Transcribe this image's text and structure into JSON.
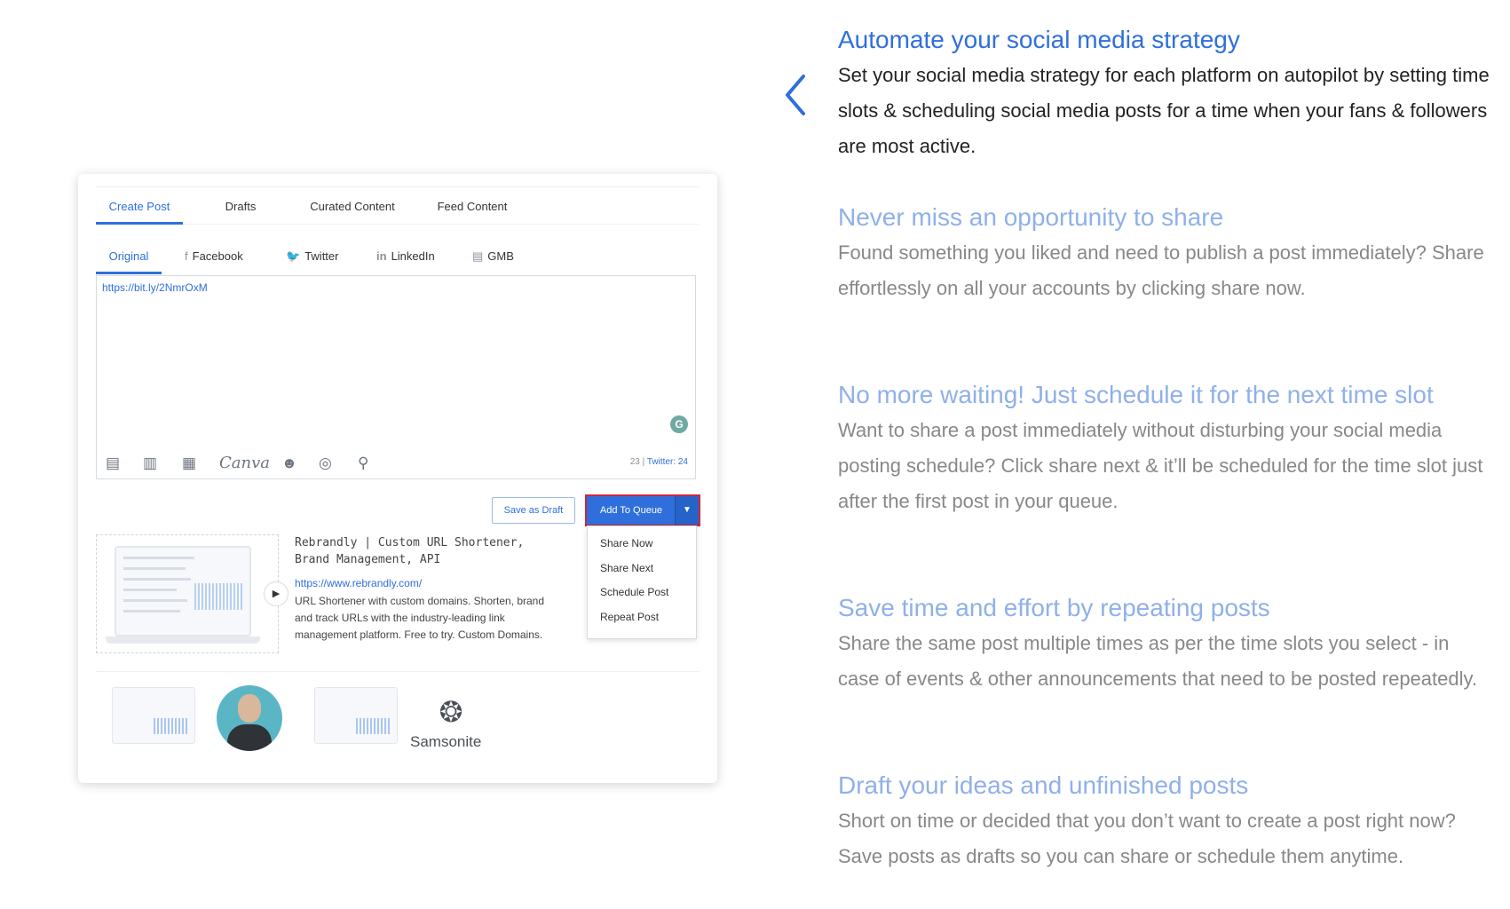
{
  "composer": {
    "tabs": [
      "Create Post",
      "Drafts",
      "Curated Content",
      "Feed Content"
    ],
    "subtabs": [
      {
        "label": "Original",
        "icon": ""
      },
      {
        "label": "Facebook",
        "icon": "f"
      },
      {
        "label": "Twitter",
        "icon": "🐦"
      },
      {
        "label": "LinkedIn",
        "icon": "in"
      },
      {
        "label": "GMB",
        "icon": "▤"
      }
    ],
    "editor_text": "https://bit.ly/2NmrOxM",
    "grammarly_icon": "G",
    "toolbar": {
      "canva": "Canva"
    },
    "counter": {
      "count": "23",
      "sep": " | ",
      "twitter": "Twitter: 24"
    },
    "save_draft_label": "Save as Draft",
    "add_queue_label": "Add To Queue",
    "queue_menu": [
      "Share Now",
      "Share Next",
      "Schedule Post",
      "Repeat Post"
    ],
    "link_preview": {
      "title": "Rebrandly | Custom URL Shortener, Brand Management, API",
      "url": "https://www.rebrandly.com/",
      "description": "URL Shortener with custom domains. Shorten, brand and track URLs with the industry-leading link management platform. Free to try. Custom Domains."
    },
    "brand": "Samsonite"
  },
  "features": [
    {
      "title": "Automate your social media strategy",
      "desc": "Set your social media strategy for each platform on autopilot by setting time slots & scheduling social media posts for a time when your fans & followers are most active."
    },
    {
      "title": "Never miss an opportunity to share",
      "desc": "Found something you liked and need to publish a post immediately? Share effortlessly on all your accounts by clicking share now."
    },
    {
      "title": "No more waiting! Just schedule it for the next time slot",
      "desc": "Want to share a post immediately without disturbing your social media posting schedule? Click share next & it’ll be scheduled for the time slot just after the first post in your queue."
    },
    {
      "title": "Save time and effort by repeating posts",
      "desc": "Share the same post multiple times as per the time slots you select - in case of events & other announcements that need to be posted repeatedly."
    },
    {
      "title": "Draft your ideas and unfinished posts",
      "desc": "Short on time or decided that you don’t want to create a post right now? Save posts as drafts so you can share or schedule them anytime."
    }
  ],
  "colors": {
    "accent": "#2f6fdc",
    "muted_title": "#8fb0ea",
    "highlight_border": "#d0263a"
  }
}
